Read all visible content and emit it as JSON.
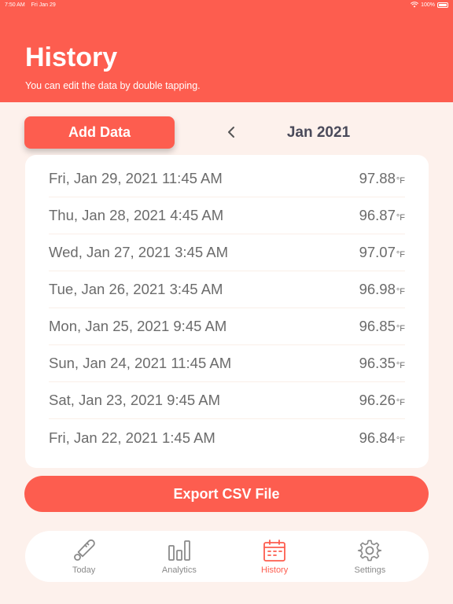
{
  "status_bar": {
    "time": "7:50 AM",
    "date": "Fri Jan 29",
    "battery": "100%"
  },
  "header": {
    "title": "History",
    "subtitle": "You can edit the data by double tapping."
  },
  "controls": {
    "add_label": "Add Data",
    "month": "Jan 2021"
  },
  "records": [
    {
      "date": "Fri, Jan 29, 2021 11:45 AM",
      "value": "97.88",
      "unit": "°F"
    },
    {
      "date": "Thu, Jan 28, 2021 4:45 AM",
      "value": "96.87",
      "unit": "°F"
    },
    {
      "date": "Wed, Jan 27, 2021 3:45 AM",
      "value": "97.07",
      "unit": "°F"
    },
    {
      "date": "Tue, Jan 26, 2021 3:45 AM",
      "value": "96.98",
      "unit": "°F"
    },
    {
      "date": "Mon, Jan 25, 2021 9:45 AM",
      "value": "96.85",
      "unit": "°F"
    },
    {
      "date": "Sun, Jan 24, 2021 11:45 AM",
      "value": "96.35",
      "unit": "°F"
    },
    {
      "date": "Sat, Jan 23, 2021 9:45 AM",
      "value": "96.26",
      "unit": "°F"
    },
    {
      "date": "Fri, Jan 22, 2021 1:45 AM",
      "value": "96.84",
      "unit": "°F"
    }
  ],
  "export_label": "Export CSV File",
  "tabs": [
    {
      "label": "Today",
      "icon": "thermometer-icon"
    },
    {
      "label": "Analytics",
      "icon": "bar-chart-icon"
    },
    {
      "label": "History",
      "icon": "calendar-icon"
    },
    {
      "label": "Settings",
      "icon": "gear-icon"
    }
  ],
  "colors": {
    "accent": "#fd5d4f",
    "background": "#fdf1ec",
    "inactive": "#8a8a8a"
  }
}
